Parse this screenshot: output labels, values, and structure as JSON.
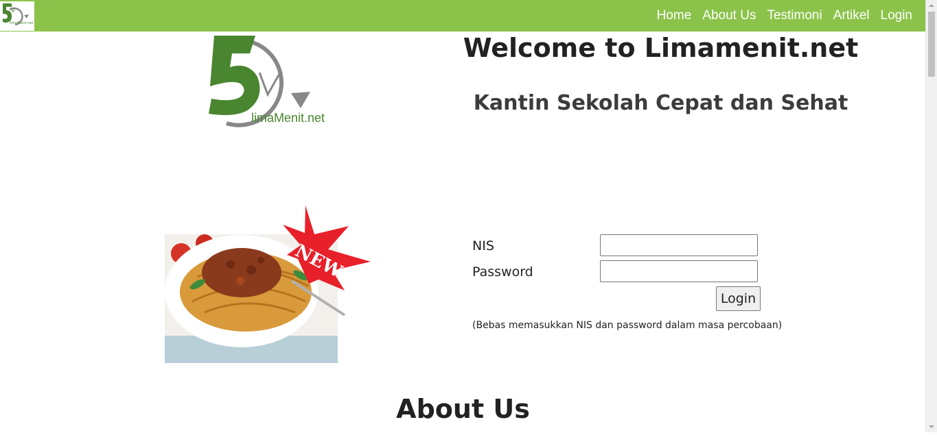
{
  "nav": {
    "logo_text": "limaMenit.net",
    "items": [
      {
        "label": "Home"
      },
      {
        "label": "About Us"
      },
      {
        "label": "Testimoni"
      },
      {
        "label": "Artikel"
      },
      {
        "label": "Login"
      }
    ]
  },
  "hero": {
    "logo_text": "limaMenit.net",
    "title": "Welcome to Limamenit.net",
    "subtitle": "Kantin Sekolah Cepat dan Sehat"
  },
  "promo": {
    "badge_text": "NEW"
  },
  "login_form": {
    "nis_label": "NIS",
    "nis_value": "",
    "password_label": "Password",
    "password_value": "",
    "submit_label": "Login",
    "note": "(Bebas memasukkan NIS dan password dalam masa percobaan)"
  },
  "about": {
    "heading": "About Us"
  },
  "colors": {
    "navbar": "#8bc34a",
    "logo_green": "#4a8530",
    "logo_grey": "#888888",
    "badge_red": "#e8202a"
  }
}
